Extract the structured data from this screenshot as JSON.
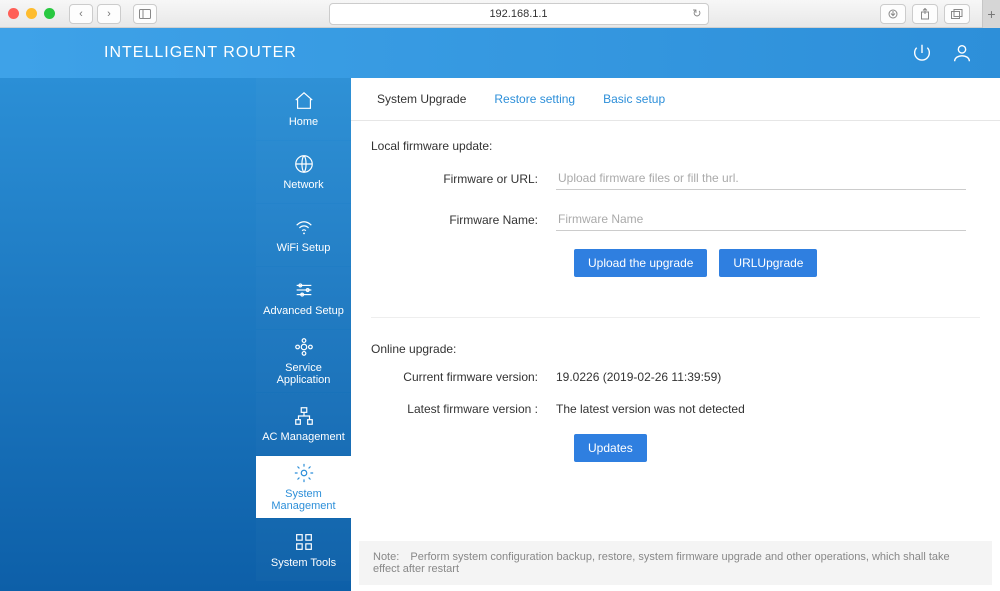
{
  "browser": {
    "url": "192.168.1.1"
  },
  "header": {
    "brand": "INTELLIGENT ROUTER"
  },
  "sidebar": {
    "items": [
      {
        "label": "Home"
      },
      {
        "label": "Network"
      },
      {
        "label": "WiFi Setup"
      },
      {
        "label": "Advanced Setup"
      },
      {
        "label": "Service Application"
      },
      {
        "label": "AC Management"
      },
      {
        "label": "System Management"
      },
      {
        "label": "System Tools"
      }
    ]
  },
  "tabs": {
    "system_upgrade": "System Upgrade",
    "restore_setting": "Restore setting",
    "basic_setup": "Basic setup"
  },
  "local": {
    "title": "Local firmware update:",
    "firmware_or_url_label": "Firmware or URL:",
    "firmware_or_url_placeholder": "Upload firmware files or fill the url.",
    "firmware_name_label": "Firmware Name:",
    "firmware_name_placeholder": "Firmware Name",
    "upload_btn": "Upload the upgrade",
    "url_upgrade_btn": "URLUpgrade"
  },
  "online": {
    "title": "Online upgrade:",
    "current_label": "Current firmware version:",
    "current_value": "19.0226  (2019-02-26 11:39:59)",
    "latest_label": "Latest firmware version :",
    "latest_value": "The latest version was not detected",
    "updates_btn": "Updates"
  },
  "note": {
    "prefix": "Note:",
    "text": "Perform system configuration backup, restore, system firmware upgrade and other operations, which shall take effect after restart"
  }
}
